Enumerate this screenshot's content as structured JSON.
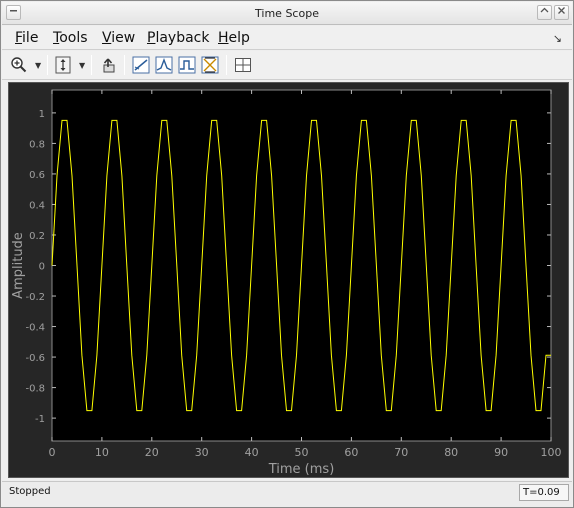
{
  "window": {
    "title": "Time Scope"
  },
  "menu": {
    "items": [
      {
        "underline": "F",
        "rest": "ile"
      },
      {
        "underline": "T",
        "rest": "ools"
      },
      {
        "underline": "V",
        "rest": "iew"
      },
      {
        "underline": "P",
        "rest": "layback"
      },
      {
        "underline": "H",
        "rest": "elp"
      }
    ]
  },
  "toolbar": {
    "icons": [
      "zoom-in-icon",
      "scale-axes-icon",
      "restore-view-icon",
      "signal-statistics-icon",
      "peak-finder-icon",
      "bilevel-measurements-icon",
      "cursor-measurements-icon",
      "layout-icon"
    ]
  },
  "colors": {
    "plot_background": "#000000",
    "panel_background": "#262626",
    "trace": "#ffff00",
    "axis_text": "#a0a0a0"
  },
  "chart_data": {
    "type": "line",
    "xlabel": "Time (ms)",
    "ylabel": "Amplitude",
    "xlim": [
      0,
      100
    ],
    "ylim": [
      -1.15,
      1.15
    ],
    "x_ticks": [
      0,
      10,
      20,
      30,
      40,
      50,
      60,
      70,
      80,
      90,
      100
    ],
    "y_ticks": [
      1,
      0.8,
      0.6,
      0.4,
      0.2,
      0,
      -0.2,
      -0.4,
      -0.6,
      -0.8,
      -1
    ],
    "y_tick_labels": [
      "1",
      "0.8",
      "0.6",
      "0.4",
      "0.2",
      "0",
      "-0.2",
      "-0.4",
      "-0.6",
      "-0.8",
      "-1"
    ],
    "grid": false,
    "series": [
      {
        "x": [
          0,
          1,
          2,
          3,
          4,
          5,
          6,
          7,
          8,
          9,
          10,
          11,
          12,
          13,
          14,
          15,
          16,
          17,
          18,
          19,
          20,
          21,
          22,
          23,
          24,
          25,
          26,
          27,
          28,
          29,
          30,
          31,
          32,
          33,
          34,
          35,
          36,
          37,
          38,
          39,
          40,
          41,
          42,
          43,
          44,
          45,
          46,
          47,
          48,
          49,
          50,
          51,
          52,
          53,
          54,
          55,
          56,
          57,
          58,
          59,
          60,
          61,
          62,
          63,
          64,
          65,
          66,
          67,
          68,
          69,
          70,
          71,
          72,
          73,
          74,
          75,
          76,
          77,
          78,
          79,
          80,
          81,
          82,
          83,
          84,
          85,
          86,
          87,
          88,
          89,
          90,
          91,
          92,
          93,
          94,
          95,
          96,
          97,
          98,
          99,
          100
        ],
        "y": [
          0,
          0.588,
          0.951,
          0.951,
          0.588,
          0,
          -0.588,
          -0.951,
          -0.951,
          -0.588,
          0,
          0.588,
          0.951,
          0.951,
          0.588,
          0,
          -0.588,
          -0.951,
          -0.951,
          -0.588,
          0,
          0.588,
          0.951,
          0.951,
          0.588,
          0,
          -0.588,
          -0.951,
          -0.951,
          -0.588,
          0,
          0.588,
          0.951,
          0.951,
          0.588,
          0,
          -0.588,
          -0.951,
          -0.951,
          -0.588,
          0,
          0.588,
          0.951,
          0.951,
          0.588,
          0,
          -0.588,
          -0.951,
          -0.951,
          -0.588,
          0,
          0.588,
          0.951,
          0.951,
          0.588,
          0,
          -0.588,
          -0.951,
          -0.951,
          -0.588,
          0,
          0.588,
          0.951,
          0.951,
          0.588,
          0,
          -0.588,
          -0.951,
          -0.951,
          -0.588,
          0,
          0.588,
          0.951,
          0.951,
          0.588,
          0,
          -0.588,
          -0.951,
          -0.951,
          -0.588,
          0,
          0.588,
          0.951,
          0.951,
          0.588,
          0,
          -0.588,
          -0.951,
          -0.951,
          -0.588,
          0,
          0.588,
          0.951,
          0.951,
          0.588,
          0,
          -0.588,
          -0.951,
          -0.951,
          -0.588,
          -0.588
        ]
      }
    ]
  },
  "status": {
    "state": "Stopped",
    "time_readout": "T=0.09"
  }
}
